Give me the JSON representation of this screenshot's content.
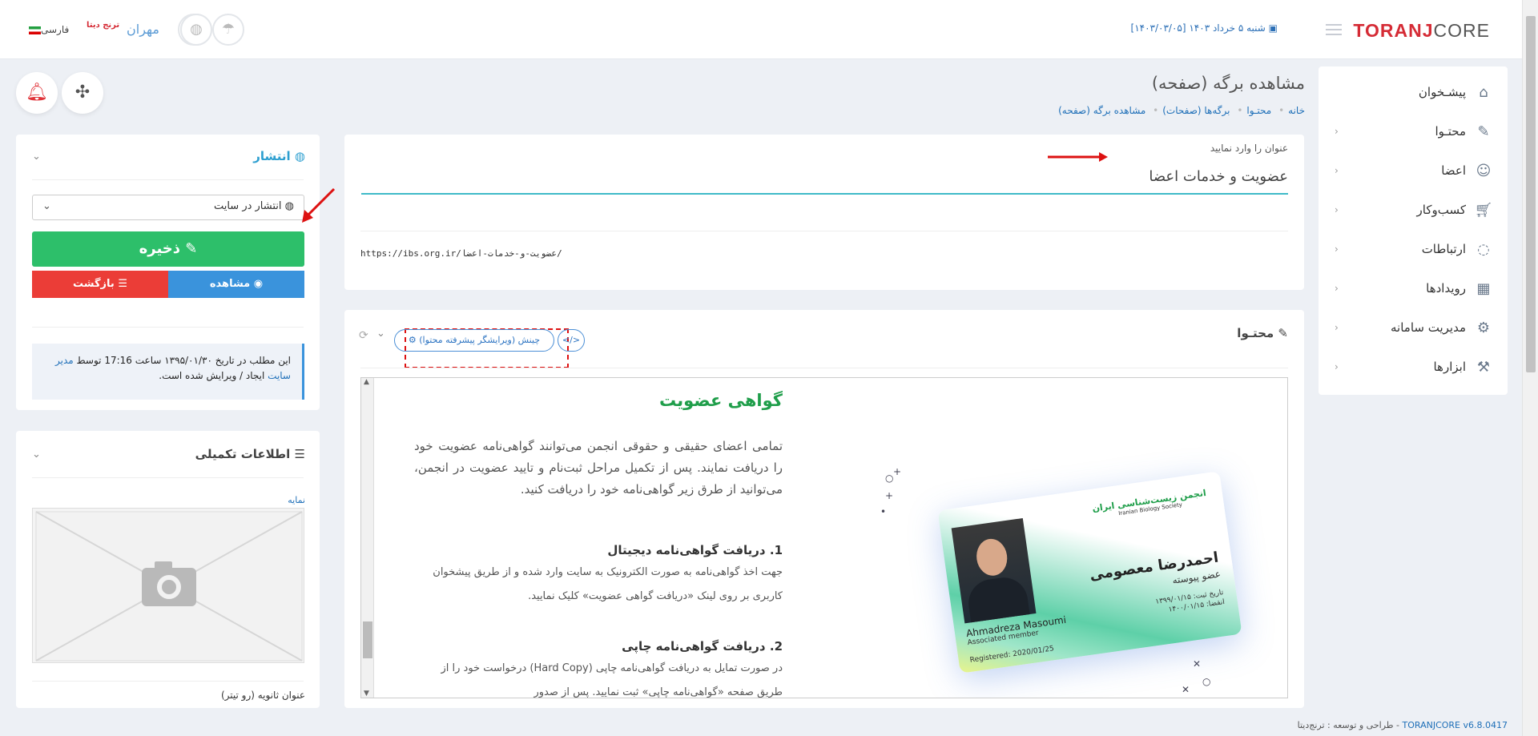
{
  "app": {
    "logo_a": "TORANJ",
    "logo_b": "CORE",
    "date": "شنبه ۵ خرداد ۱۴۰۳ [۱۴۰۳/۰۳/۰۵]",
    "user_name": "مهران",
    "language": "فارسی",
    "brand_mini": "ترنج دیتا"
  },
  "sidebar": {
    "items": [
      {
        "label": "پیشـخوان",
        "icon": "home-icon",
        "has_sub": false
      },
      {
        "label": "محتـوا",
        "icon": "edit-icon",
        "has_sub": true
      },
      {
        "label": "اعضا",
        "icon": "users-icon",
        "has_sub": true
      },
      {
        "label": "کسب‌وکار",
        "icon": "cart-icon",
        "has_sub": true
      },
      {
        "label": "ارتباطات",
        "icon": "chat-icon",
        "has_sub": true
      },
      {
        "label": "رویدادها",
        "icon": "calendar-icon",
        "has_sub": true
      },
      {
        "label": "مدیریت سامانه",
        "icon": "gear-icon",
        "has_sub": true
      },
      {
        "label": "ابزارها",
        "icon": "wrench-icon",
        "has_sub": true
      }
    ]
  },
  "page": {
    "title": "مشاهده برگه (صفحه)",
    "breadcrumbs": [
      "خانه",
      "محتـوا",
      "برگه‌ها (صفحات)",
      "مشاهده برگه (صفحه)"
    ]
  },
  "form": {
    "title_label": "عنوان را وارد نمایید",
    "title_value": "عضویت و خدمات اعضا",
    "url": "https://ibs.org.ir/عضویت-و-خدمات-اعضا/"
  },
  "content": {
    "heading": "محتـوا",
    "layout_button": "چینش (ویرایشگر پیشرفته محتوا)",
    "editor": {
      "h1": "گواهی عضویت",
      "p1": "تمامی اعضای حقیقی و حقوقی انجمن می‌توانند گواهی‌نامه عضویت خود را دریافت نمایند. پس از تکمیل مراحل ثبت‌نام و تایید عضویت در انجمن، می‌توانید از طرق زیر گواهی‌نامه خود را دریافت کنید.",
      "h2": "1. دریافت گواهی‌نامه دیجیتال",
      "p2": "جهت اخذ گواهی‌نامه به صورت الکترونیک به سایت وارد شده و از طریق پیشخوان کاربری بر روی لینک «دریافت گواهی عضویت» کلیک نمایید.",
      "h3": "2. دریافت گواهی‌نامه چاپی",
      "p3": "در صورت تمایل به دریافت گواهی‌نامه چاپی (Hard Copy) درخواست خود را از طریق صفحه «گواهی‌نامه چاپی» ثبت نمایید. پس از صدور"
    },
    "id_card": {
      "org_fa": "انجمن زیست‌شناسی ایران",
      "org_en": "Iranian Biology Society",
      "name_fa": "احمدرضا معصومی",
      "role_fa": "عضو پیوسته",
      "name_en": "Ahmadreza Masoumi",
      "role_en": "Associated member",
      "registered": "Registered: 2020/01/25",
      "reg_date": "تاریخ ثبت: ۱۳۹۹/۰۱/۱۵",
      "exp_date": "انقضا: ۱۴۰۰/۰۱/۱۵"
    }
  },
  "publish": {
    "heading": "انتشار",
    "status_select": "انتشار در سایت",
    "save": "ذخیره",
    "view": "مشاهده",
    "back": "بازگشت",
    "info_text": "این مطلب در تاریخ ۱۳۹۵/۰۱/۳۰ ساعت 17:16 توسط",
    "info_link": "مدیر سایت",
    "info_tail": "ایجاد / ویرایش شده است."
  },
  "extra": {
    "heading": "اطلاعات تکمیلی",
    "image_label": "نمایه",
    "subtitle_label": "عنوان ثانویه (رو تیتر)"
  },
  "footer": {
    "version": "TORANJCORE v6.8.0417",
    "credit": " - طراحی و توسعه : ترنج‌دیتا"
  }
}
